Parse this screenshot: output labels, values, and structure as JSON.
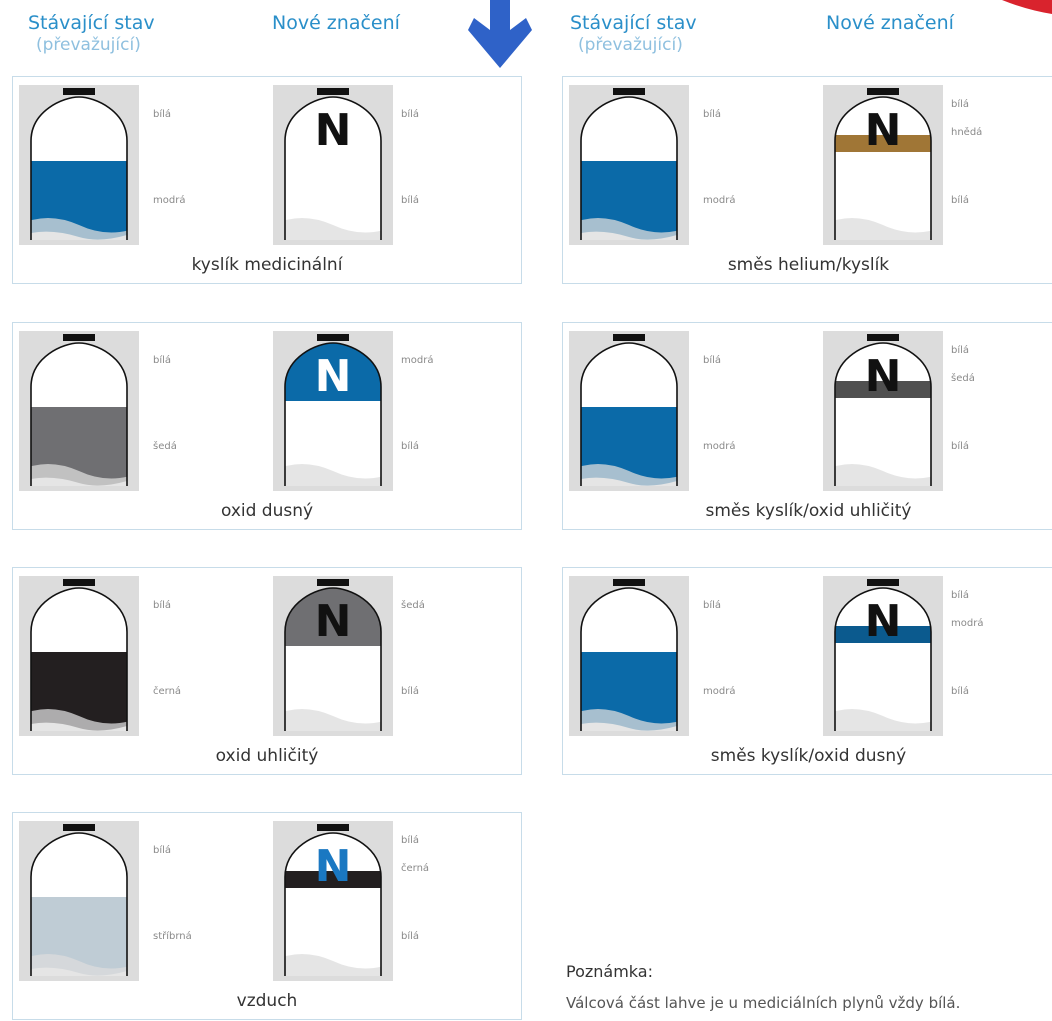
{
  "headers": {
    "left": {
      "current": "Stávající stav",
      "current_sub": "(převažující)",
      "new": "Nové značení"
    },
    "right": {
      "current": "Stávající stav",
      "current_sub": "(převažující)",
      "new": "Nové značení"
    }
  },
  "marker_letter": "N",
  "colors": {
    "blue": "#0b6aa8",
    "white": "#ffffff",
    "grey": "#6f6f72",
    "black": "#231f20",
    "silver": "#bfccd5",
    "brown": "#a07636",
    "darkgrey": "#505050",
    "navy": "#0b5a8e",
    "bg_grey": "#dcdcdc"
  },
  "panels": [
    {
      "name": "kyslík medicinální",
      "old": {
        "top_label": "bílá",
        "body_label": "modrá",
        "body_color": "blue"
      },
      "new": {
        "shoulder_color": "white",
        "band_color": null,
        "letter_color": "#111111",
        "labels": [
          "bílá",
          "bílá"
        ]
      }
    },
    {
      "name": "oxid dusný",
      "old": {
        "top_label": "bílá",
        "body_label": "šedá",
        "body_color": "grey"
      },
      "new": {
        "shoulder_color": "blue",
        "band_color": null,
        "letter_color": "#ffffff",
        "labels": [
          "modrá",
          "bílá"
        ]
      }
    },
    {
      "name": "oxid uhličitý",
      "old": {
        "top_label": "bílá",
        "body_label": "černá",
        "body_color": "black"
      },
      "new": {
        "shoulder_color": "grey",
        "band_color": null,
        "letter_color": "#111111",
        "labels": [
          "šedá",
          "bílá"
        ]
      }
    },
    {
      "name": "vzduch",
      "old": {
        "top_label": "bílá",
        "body_label": "stříbrná",
        "body_color": "silver"
      },
      "new": {
        "shoulder_color": "white",
        "band_color": "black",
        "letter_color": "#1a78c2",
        "labels": [
          "bílá",
          "černá",
          "bílá"
        ]
      }
    },
    {
      "name": "směs helium/kyslík",
      "old": {
        "top_label": "bílá",
        "body_label": "modrá",
        "body_color": "blue"
      },
      "new": {
        "shoulder_color": "white",
        "band_color": "brown",
        "letter_color": "#111111",
        "labels": [
          "bílá",
          "hnědá",
          "bílá"
        ]
      }
    },
    {
      "name": "směs kyslík/oxid uhličitý",
      "old": {
        "top_label": "bílá",
        "body_label": "modrá",
        "body_color": "blue"
      },
      "new": {
        "shoulder_color": "white",
        "band_color": "darkgrey",
        "letter_color": "#111111",
        "labels": [
          "bílá",
          "šedá",
          "bílá"
        ]
      }
    },
    {
      "name": "směs kyslík/oxid dusný",
      "old": {
        "top_label": "bílá",
        "body_label": "modrá",
        "body_color": "blue"
      },
      "new": {
        "shoulder_color": "white",
        "band_color": "navy",
        "letter_color": "#111111",
        "labels": [
          "bílá",
          "modrá",
          "bílá"
        ]
      }
    }
  ],
  "note": {
    "title": "Poznámka:",
    "text": "Válcová část lahve je u mediciálních plynů vždy bílá."
  }
}
